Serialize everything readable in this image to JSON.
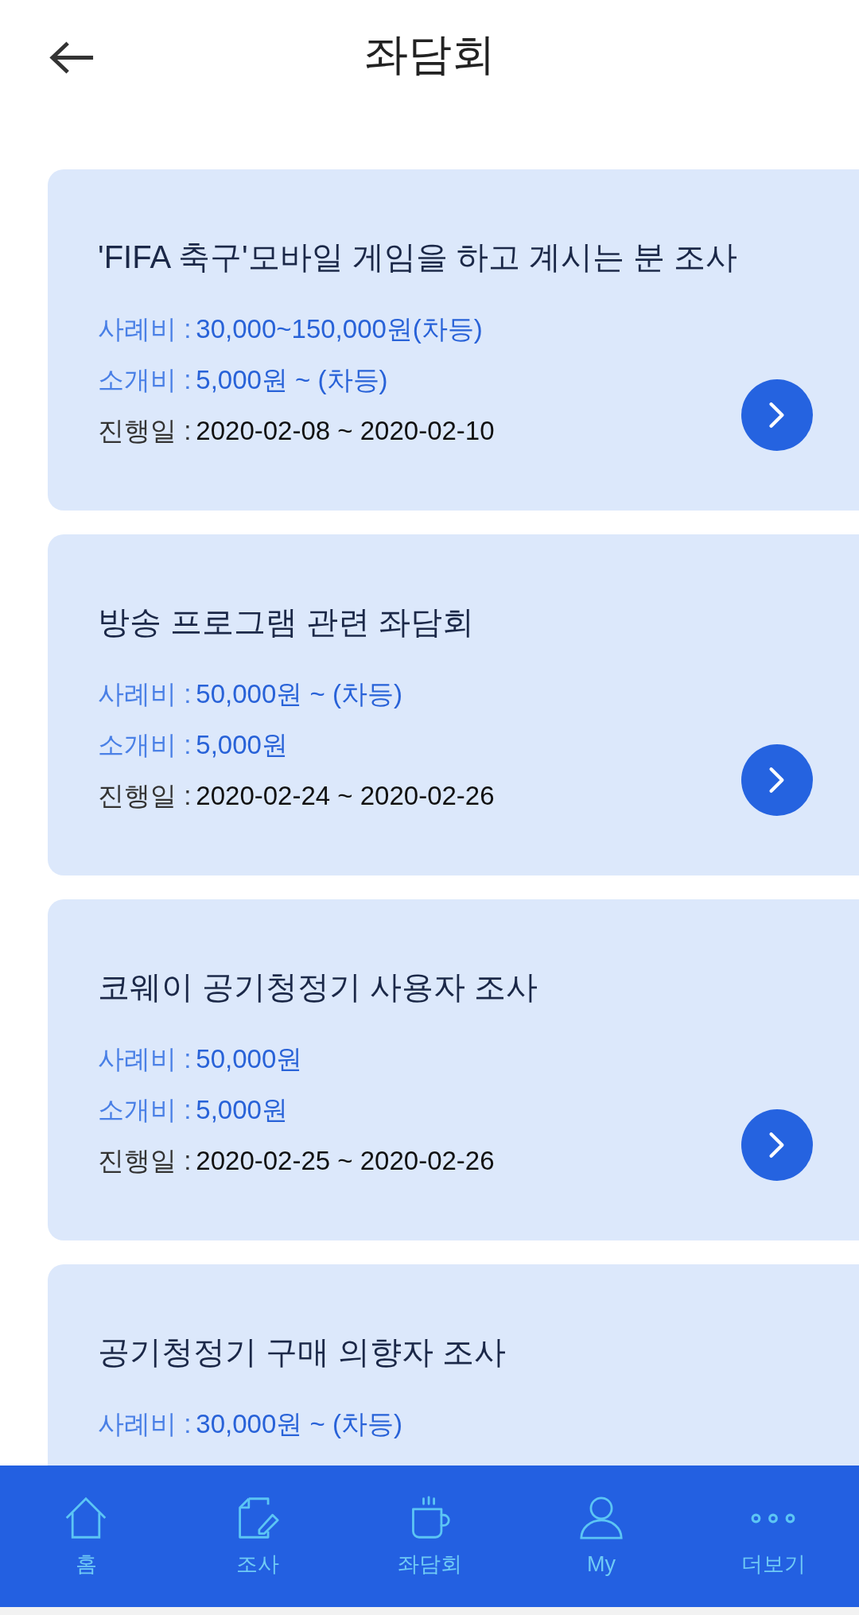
{
  "header": {
    "title": "좌담회"
  },
  "cards": [
    {
      "title": "'FIFA 축구'모바일 게임을 하고 계시는 분 조사",
      "lines": [
        {
          "kind": "fee",
          "label": "사례비 :",
          "value": "30,000~150,000원(차등)"
        },
        {
          "kind": "fee",
          "label": "소개비 :",
          "value": "5,000원 ~ (차등)"
        },
        {
          "kind": "date",
          "label": "진행일 :",
          "value": "2020-02-08 ~ 2020-02-10"
        }
      ],
      "next_button": true
    },
    {
      "title": "방송 프로그램 관련 좌담회",
      "lines": [
        {
          "kind": "fee",
          "label": "사례비 :",
          "value": "50,000원 ~ (차등)"
        },
        {
          "kind": "fee",
          "label": "소개비 :",
          "value": "5,000원"
        },
        {
          "kind": "date",
          "label": "진행일 :",
          "value": "2020-02-24 ~ 2020-02-26"
        }
      ],
      "next_button": true
    },
    {
      "title": "코웨이 공기청정기 사용자 조사",
      "lines": [
        {
          "kind": "fee",
          "label": "사례비 :",
          "value": "50,000원"
        },
        {
          "kind": "fee",
          "label": "소개비 :",
          "value": "5,000원"
        },
        {
          "kind": "date",
          "label": "진행일 :",
          "value": "2020-02-25 ~ 2020-02-26"
        }
      ],
      "next_button": true
    },
    {
      "title": "공기청정기 구매 의향자 조사",
      "lines": [
        {
          "kind": "fee",
          "label": "사례비 :",
          "value": "30,000원 ~ (차등)"
        }
      ],
      "next_button": false
    }
  ],
  "bottom_nav": {
    "items": [
      {
        "kind": "home",
        "label": "홈"
      },
      {
        "kind": "survey",
        "label": "조사"
      },
      {
        "kind": "cup",
        "label": "좌담회"
      },
      {
        "kind": "person",
        "label": "My"
      },
      {
        "kind": "more",
        "label": "더보기"
      }
    ]
  }
}
